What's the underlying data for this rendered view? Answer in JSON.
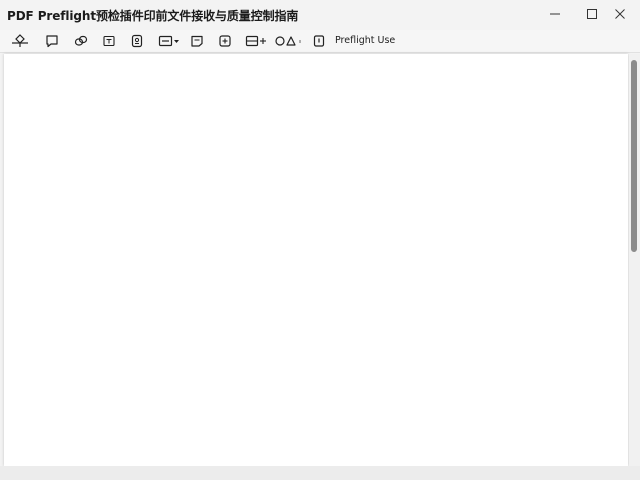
{
  "window": {
    "title": "PDF Preflight预检插件印前文件接收与质量控制指南"
  },
  "window_controls": {
    "minimize": "minimize-icon",
    "maximize": "maximize-icon",
    "close": "close-icon"
  },
  "toolbar": {
    "items": [
      {
        "name": "navigate-icon"
      },
      {
        "name": "comment-icon"
      },
      {
        "name": "link-icon"
      },
      {
        "name": "text-box-icon"
      },
      {
        "name": "stamp-icon"
      },
      {
        "name": "form-field-dropdown-icon"
      },
      {
        "name": "note-icon"
      },
      {
        "name": "image-icon"
      },
      {
        "name": "table-add-icon"
      },
      {
        "name": "shapes-icon"
      },
      {
        "name": "preflight-icon"
      }
    ],
    "preflight_label": "Preflight Use"
  }
}
